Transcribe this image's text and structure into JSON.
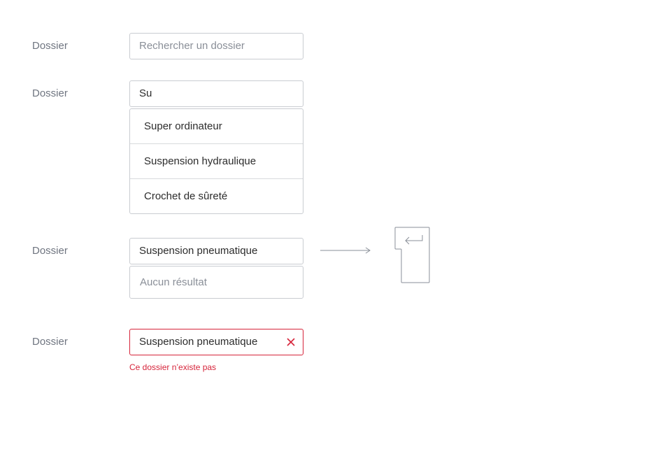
{
  "rows": [
    {
      "label": "Dossier",
      "placeholder": "Rechercher un dossier"
    },
    {
      "label": "Dossier",
      "value": "Su",
      "options": [
        "Super ordinateur",
        "Suspension hydraulique",
        "Crochet de sûreté"
      ]
    },
    {
      "label": "Dossier",
      "value": "Suspension pneumatique",
      "empty_text": "Aucun résultat"
    },
    {
      "label": "Dossier",
      "value": "Suspension pneumatique",
      "error": "Ce dossier n’existe pas"
    }
  ],
  "icons": {
    "arrow": "arrow-right-icon",
    "enter_key": "enter-key-icon",
    "clear": "close-icon"
  },
  "colors": {
    "error": "#d6243a",
    "border": "#c9ccd1",
    "label": "#6f7580",
    "placeholder": "#8a8f98"
  }
}
